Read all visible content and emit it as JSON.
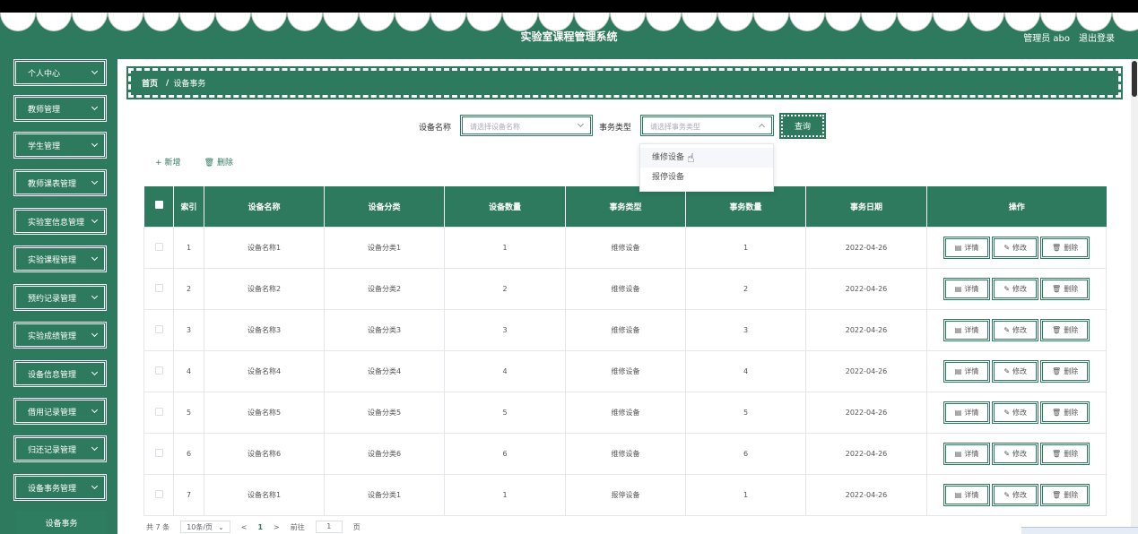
{
  "header": {
    "title": "实验室课程管理系统",
    "user_label": "管理员 abo",
    "logout_label": "退出登录"
  },
  "sidebar": {
    "items": [
      {
        "label": "个人中心"
      },
      {
        "label": "教师管理"
      },
      {
        "label": "学生管理"
      },
      {
        "label": "教师课表管理"
      },
      {
        "label": "实验室信息管理"
      },
      {
        "label": "实验课程管理"
      },
      {
        "label": "预约记录管理"
      },
      {
        "label": "实验成绩管理"
      },
      {
        "label": "设备信息管理"
      },
      {
        "label": "借用记录管理"
      },
      {
        "label": "归还记录管理"
      },
      {
        "label": "设备事务管理"
      }
    ],
    "active_sub": "设备事务"
  },
  "breadcrumb": {
    "home": "首页",
    "sep": "/",
    "current": "设备事务"
  },
  "search": {
    "device_name_label": "设备名称",
    "device_name_placeholder": "请选择设备名称",
    "type_label": "事务类型",
    "type_placeholder": "请选择事务类型",
    "query_label": "查询",
    "dropdown_options": [
      "维修设备",
      "报停设备"
    ]
  },
  "actions": {
    "add_label": "新增",
    "delete_label": "删除"
  },
  "table": {
    "columns": [
      "索引",
      "设备名称",
      "设备分类",
      "设备数量",
      "事务类型",
      "事务数量",
      "事务日期",
      "操作"
    ],
    "rows": [
      {
        "index": "1",
        "name": "设备名称1",
        "category": "设备分类1",
        "qty": "1",
        "type": "维修设备",
        "tqty": "1",
        "date": "2022-04-26"
      },
      {
        "index": "2",
        "name": "设备名称2",
        "category": "设备分类2",
        "qty": "2",
        "type": "维修设备",
        "tqty": "2",
        "date": "2022-04-26"
      },
      {
        "index": "3",
        "name": "设备名称3",
        "category": "设备分类3",
        "qty": "3",
        "type": "维修设备",
        "tqty": "3",
        "date": "2022-04-26"
      },
      {
        "index": "4",
        "name": "设备名称4",
        "category": "设备分类4",
        "qty": "4",
        "type": "维修设备",
        "tqty": "4",
        "date": "2022-04-26"
      },
      {
        "index": "5",
        "name": "设备名称5",
        "category": "设备分类5",
        "qty": "5",
        "type": "维修设备",
        "tqty": "5",
        "date": "2022-04-26"
      },
      {
        "index": "6",
        "name": "设备名称6",
        "category": "设备分类6",
        "qty": "6",
        "type": "维修设备",
        "tqty": "6",
        "date": "2022-04-26"
      },
      {
        "index": "7",
        "name": "设备名称1",
        "category": "设备分类1",
        "qty": "1",
        "type": "报停设备",
        "tqty": "1",
        "date": "2022-04-26"
      }
    ],
    "row_actions": {
      "detail": "详情",
      "edit": "修改",
      "delete": "删除"
    }
  },
  "pager": {
    "total_label": "共 7 条",
    "page_size": "10条/页",
    "current_page": "1",
    "goto_label": "前往",
    "goto_value": "1",
    "page_suffix": "页"
  },
  "colors": {
    "primary": "#2e7a5e",
    "header_bg": "#2e7a5e"
  }
}
